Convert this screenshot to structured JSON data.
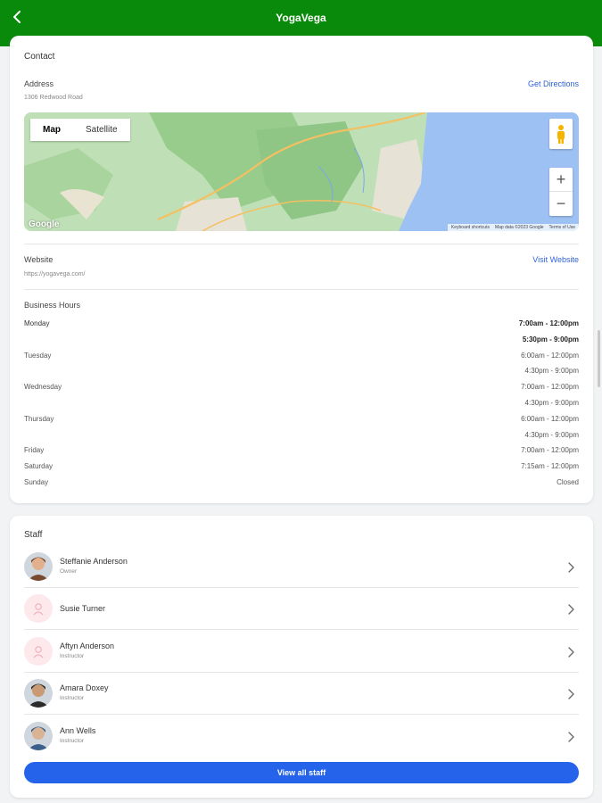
{
  "header": {
    "title": "YogaVega",
    "back_icon": "chevron-left-icon"
  },
  "contact": {
    "title": "Contact",
    "address_label": "Address",
    "address_value": "1306 Redwood Road",
    "directions_label": "Get Directions",
    "map": {
      "map_label": "Map",
      "satellite_label": "Satellite",
      "google_label": "Google",
      "attribution": [
        "Keyboard shortcuts",
        "Map data ©2023 Google",
        "Terms of Use"
      ]
    },
    "website_label": "Website",
    "website_value": "https://yogavega.com/",
    "visit_label": "Visit Website",
    "hours_label": "Business Hours",
    "hours": [
      {
        "day": "Monday",
        "time": "7:00am - 12:00pm",
        "today": true
      },
      {
        "day": "",
        "time": "5:30pm - 9:00pm",
        "today": true
      },
      {
        "day": "Tuesday",
        "time": "6:00am - 12:00pm"
      },
      {
        "day": "",
        "time": "4:30pm - 9:00pm"
      },
      {
        "day": "Wednesday",
        "time": "7:00am - 12:00pm"
      },
      {
        "day": "",
        "time": "4:30pm - 9:00pm"
      },
      {
        "day": "Thursday",
        "time": "6:00am - 12:00pm"
      },
      {
        "day": "",
        "time": "4:30pm - 9:00pm"
      },
      {
        "day": "Friday",
        "time": "7:00am - 12:00pm"
      },
      {
        "day": "Saturday",
        "time": "7:15am - 12:00pm"
      },
      {
        "day": "Sunday",
        "time": "Closed"
      }
    ]
  },
  "staff": {
    "title": "Staff",
    "members": [
      {
        "name": "Steffanie Anderson",
        "role": "Owner",
        "photo": true
      },
      {
        "name": "Susie Turner",
        "role": "",
        "photo": false
      },
      {
        "name": "Aftyn Anderson",
        "role": "Instructor",
        "photo": false
      },
      {
        "name": "Amara Doxey",
        "role": "Instructor",
        "photo": true
      },
      {
        "name": "Ann Wells",
        "role": "Instructor",
        "photo": true
      }
    ],
    "view_all_label": "View all staff"
  },
  "colors": {
    "header": "#0a8a0a",
    "link": "#2f62d8",
    "button": "#2563eb"
  }
}
